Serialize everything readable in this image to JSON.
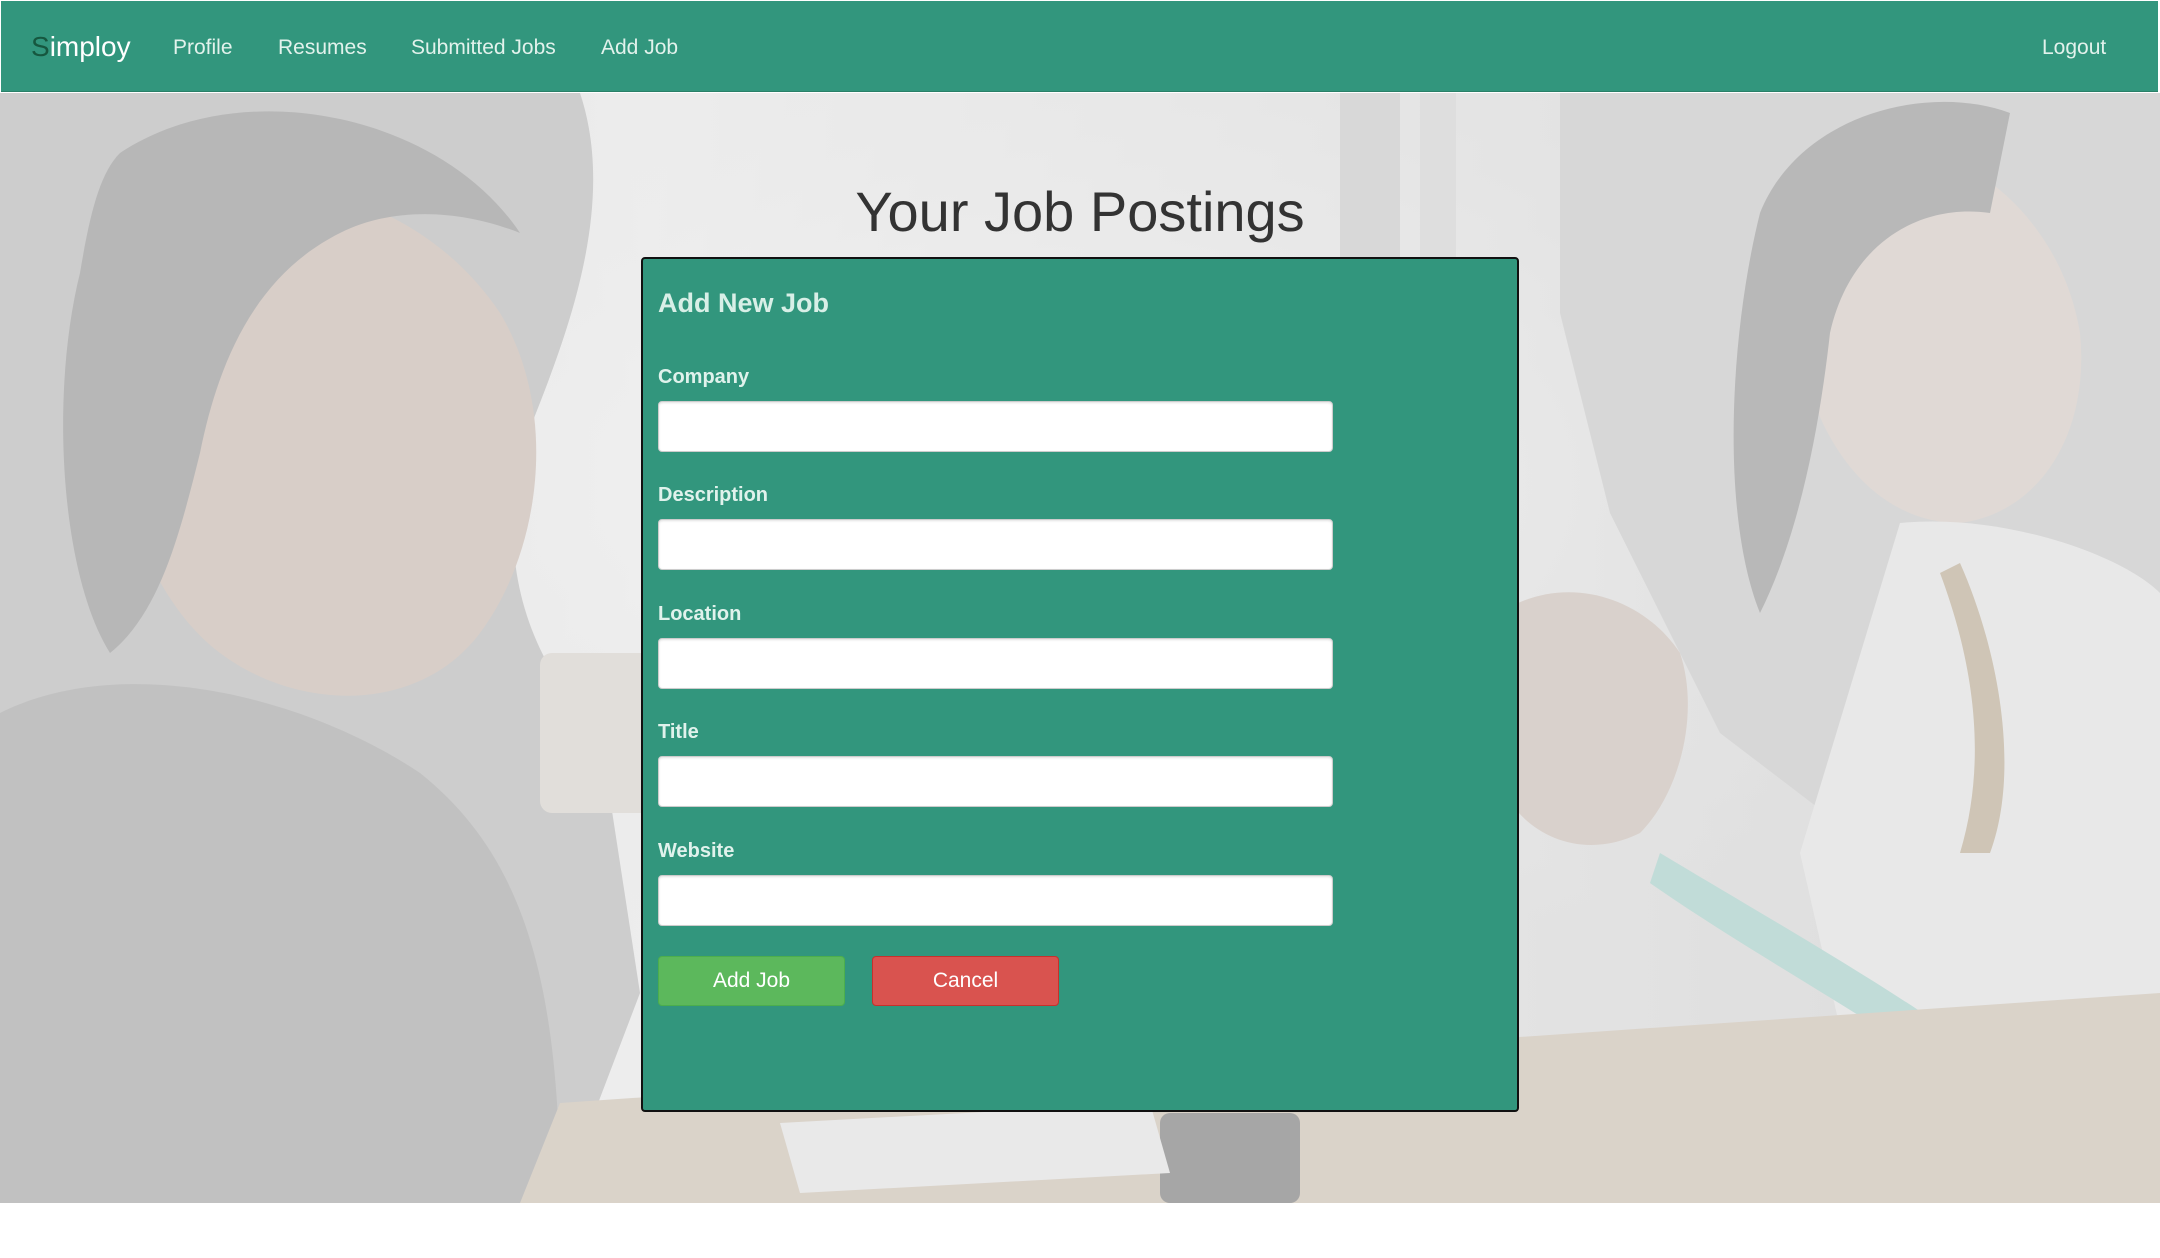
{
  "navbar": {
    "brand_first_letter": "S",
    "brand_rest": "imploy",
    "links": [
      {
        "label": "Profile"
      },
      {
        "label": "Resumes"
      },
      {
        "label": "Submitted Jobs"
      },
      {
        "label": "Add Job"
      }
    ],
    "logout_label": "Logout"
  },
  "page": {
    "title": "Your Job Postings"
  },
  "form": {
    "title": "Add New Job",
    "fields": [
      {
        "label": "Company",
        "value": ""
      },
      {
        "label": "Description",
        "value": ""
      },
      {
        "label": "Location",
        "value": ""
      },
      {
        "label": "Title",
        "value": ""
      },
      {
        "label": "Website",
        "value": ""
      }
    ],
    "submit_label": "Add Job",
    "cancel_label": "Cancel"
  },
  "colors": {
    "brand_green": "#32967d",
    "brand_accent": "#16573f",
    "success": "#5cb85c",
    "danger": "#d9534f"
  }
}
